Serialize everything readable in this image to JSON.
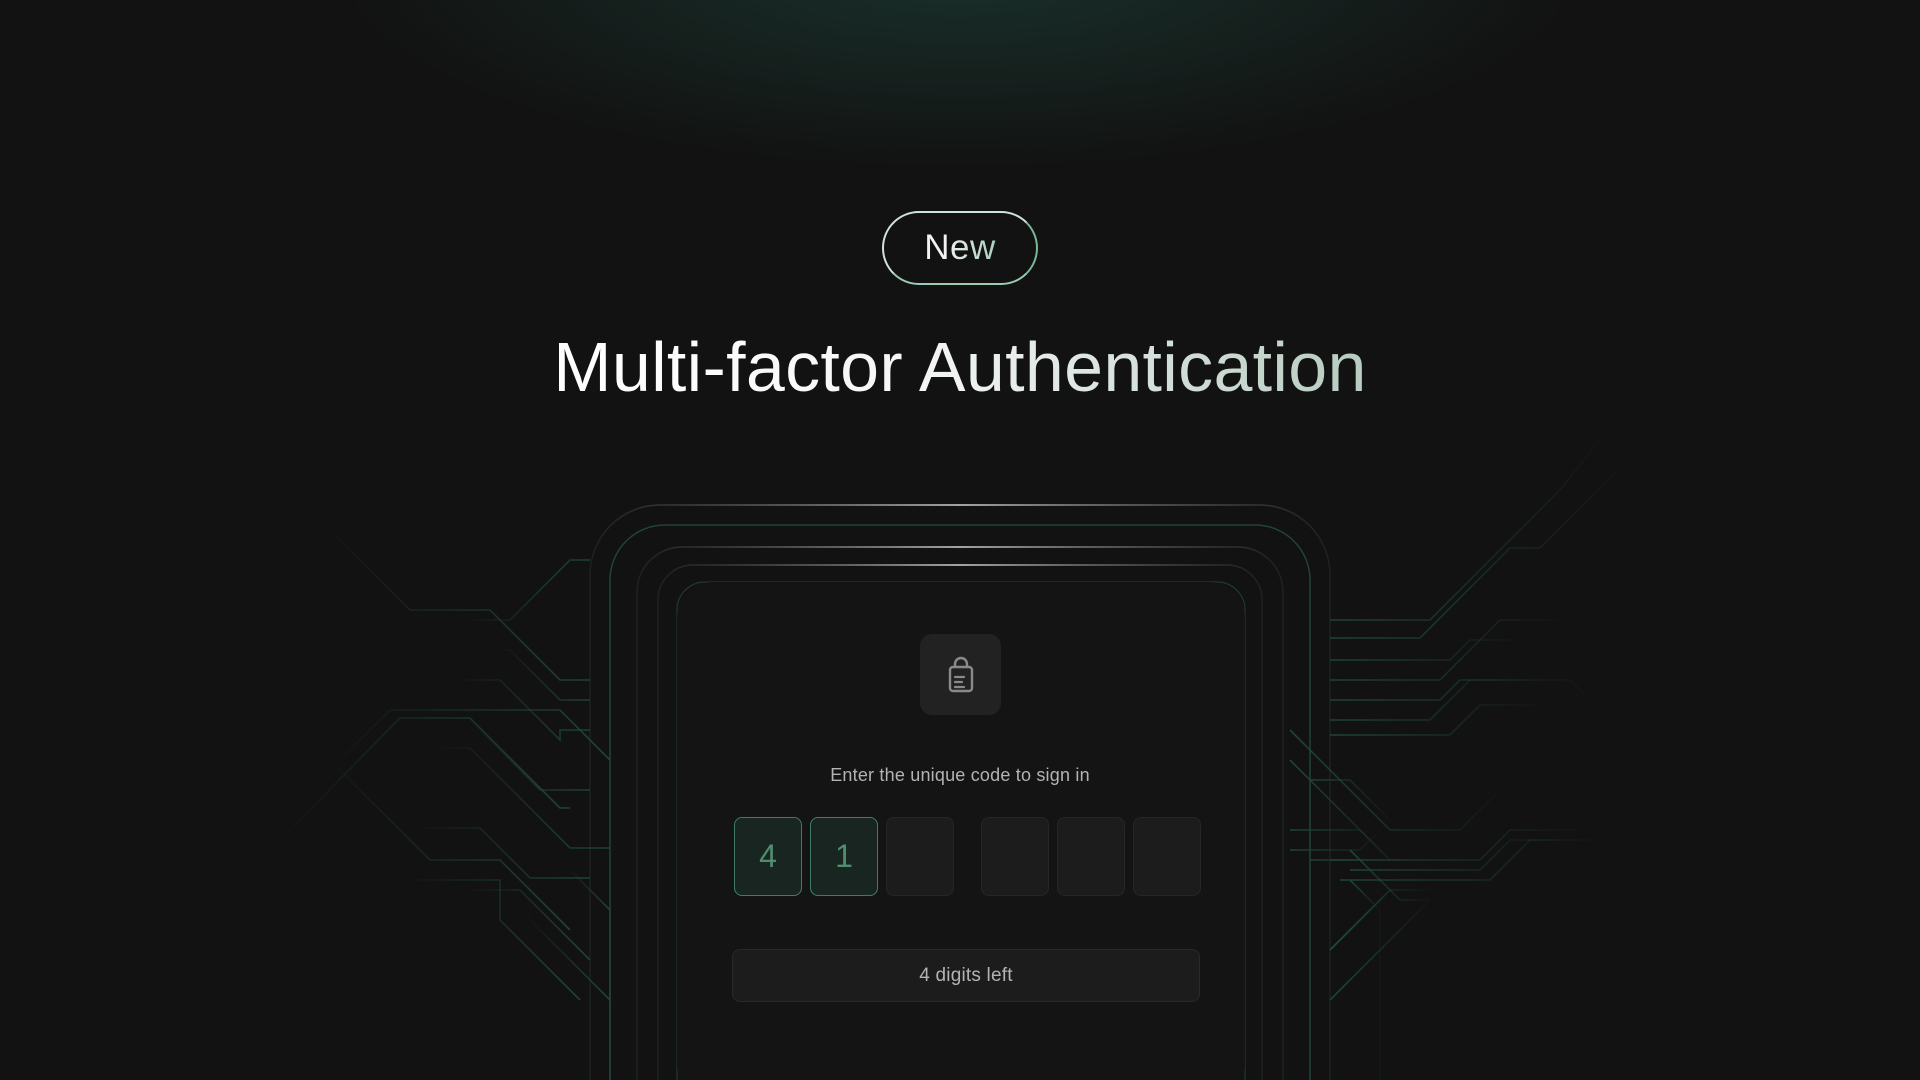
{
  "badge": {
    "label": "New"
  },
  "headline": "Multi-factor Authentication",
  "card": {
    "icon": "lock-document-icon",
    "prompt": "Enter the unique code to sign in",
    "code": {
      "length": 6,
      "digits": [
        "4",
        "1",
        "",
        "",
        "",
        ""
      ]
    },
    "status": "4 digits left"
  },
  "colors": {
    "background": "#121212",
    "accent": "#4f8c70",
    "accent_border": "#3f7d63",
    "text_primary": "#ffffff",
    "text_muted": "#b3b3b3"
  }
}
